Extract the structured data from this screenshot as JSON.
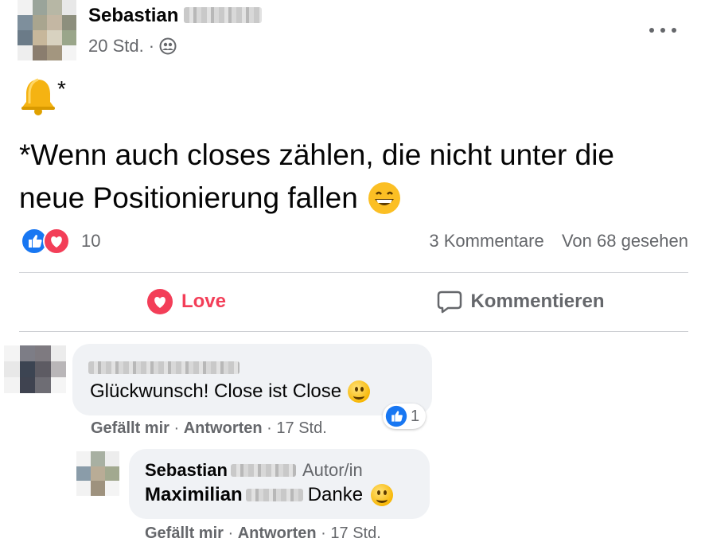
{
  "post": {
    "author": "Sebastian",
    "time": "20 Std.",
    "dot": "·",
    "bell_suffix": "*",
    "text_line1": "*Wenn auch closes zählen, die nicht unter die",
    "text_line2": "neue Positionierung fallen"
  },
  "stats": {
    "reactions_count": "10",
    "comments": "3 Kommentare",
    "views": "Von 68 gesehen"
  },
  "actions": {
    "love": "Love",
    "comment": "Kommentieren"
  },
  "comment1": {
    "text": "Glückwunsch! Close ist Close",
    "like": "Gefällt mir",
    "reply": "Antworten",
    "time": "17 Std.",
    "reaction_count": "1",
    "sep": "·"
  },
  "reply1": {
    "author": "Sebastian",
    "role": "Autor/in",
    "mention": "Maximilian",
    "text": "Danke",
    "like": "Gefällt mir",
    "reply": "Antworten",
    "time": "17 Std.",
    "sep": "·"
  },
  "colors": {
    "love_red": "#f33e58",
    "like_blue": "#1877f2",
    "meta_gray": "#65676b",
    "divider": "#ced0d4",
    "bubble": "#f0f2f5"
  },
  "icons": [
    "more-options-icon",
    "globe-friends-icon",
    "bell-emoji",
    "grin-emoji",
    "like-reaction-icon",
    "love-reaction-icon",
    "heart-icon",
    "comment-icon",
    "smile-emoji"
  ]
}
